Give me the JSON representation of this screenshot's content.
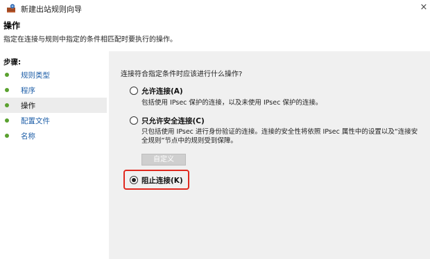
{
  "window": {
    "title": "新建出站规则向导",
    "close_glyph": "×"
  },
  "header": {
    "title": "操作",
    "subtitle": "指定在连接与规则中指定的条件相匹配时要执行的操作。"
  },
  "steps": {
    "header": "步骤:",
    "items": [
      {
        "label": "规则类型",
        "active": false
      },
      {
        "label": "程序",
        "active": false
      },
      {
        "label": "操作",
        "active": true
      },
      {
        "label": "配置文件",
        "active": false
      },
      {
        "label": "名称",
        "active": false
      }
    ]
  },
  "main": {
    "question": "连接符合指定条件时应该进行什么操作?",
    "options": [
      {
        "label": "允许连接(A)",
        "checked": false,
        "description": "包括使用 IPsec 保护的连接，以及未使用 IPsec 保护的连接。"
      },
      {
        "label": "只允许安全连接(C)",
        "checked": false,
        "description": "只包括使用 IPsec 进行身份验证的连接。连接的安全性将依照 IPsec 属性中的设置以及“连接安全规则”节点中的规则受到保障。"
      },
      {
        "label": "阻止连接(K)",
        "checked": true,
        "description": ""
      }
    ],
    "customize_label": "自定义"
  },
  "colors": {
    "highlight": "#e0281e",
    "step_dot": "#5aa12f",
    "link": "#1f5fa8",
    "content_bg": "#f0f0f0"
  }
}
